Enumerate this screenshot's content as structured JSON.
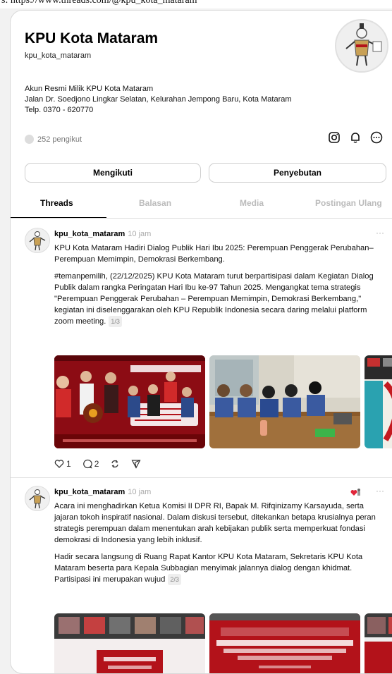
{
  "browser_strip": "s: https://www.threads.com/@kpu_kota_mataram",
  "profile": {
    "name": "KPU Kota Mataram",
    "handle": "kpu_kota_mataram",
    "bio": [
      "Akun Resmi Milik KPU Kota Mataram",
      "Jalan Dr. Soedjono Lingkar Selatan, Kelurahan Jempong Baru, Kota Mataram",
      "Telp. 0370 - 620770"
    ],
    "followers": "252 pengikut"
  },
  "buttons": {
    "follow": "Mengikuti",
    "mention": "Penyebutan"
  },
  "tabs": [
    "Threads",
    "Balasan",
    "Media",
    "Postingan Ulang"
  ],
  "posts": [
    {
      "user": "kpu_kota_mataram",
      "time": "10 jam",
      "paragraph1": "KPU Kota Mataram Hadiri Dialog Publik Hari Ibu 2025: Perempuan Penggerak Perubahan–Perempuan Memimpin, Demokrasi Berkembang.",
      "paragraph2": "#temanpemilih, (22/12/2025) KPU Kota Mataram turut berpartisipasi dalam Kegiatan Dialog Publik dalam rangka Peringatan Hari Ibu ke-97 Tahun 2025. Mengangkat tema strategis \"Perempuan Penggerak Perubahan – Perempuan Memimpin, Demokrasi Berkembang,\" kegiatan ini diselenggarakan oleh KPU Republik Indonesia secara daring melalui platform zoom meeting.",
      "pager": "1/3",
      "likes": "1",
      "replies": "2"
    },
    {
      "user": "kpu_kota_mataram",
      "time": "10 jam",
      "paragraph1": "Acara ini menghadirkan Ketua Komisi II DPR RI, Bapak M. Rifqinizamy Karsayuda, serta jajaran tokoh inspiratif nasional. Dalam diskusi tersebut, ditekankan betapa krusialnya peran strategis perempuan dalam menentukan arah kebijakan publik serta memperkuat fondasi demokrasi di Indonesia yang lebih inklusif.",
      "paragraph2": "Hadir secara langsung di Ruang Rapat Kantor KPU Kota Mataram, Sekretaris KPU Kota Mataram beserta para Kepala Subbagian menyimak jalannya dialog dengan khidmat. Partisipasi ini merupakan wujud",
      "pager": "2/3"
    }
  ],
  "colors": {
    "accent_red": "#b3121a",
    "muted": "#aaaaaa",
    "border": "#d8d8d8"
  }
}
